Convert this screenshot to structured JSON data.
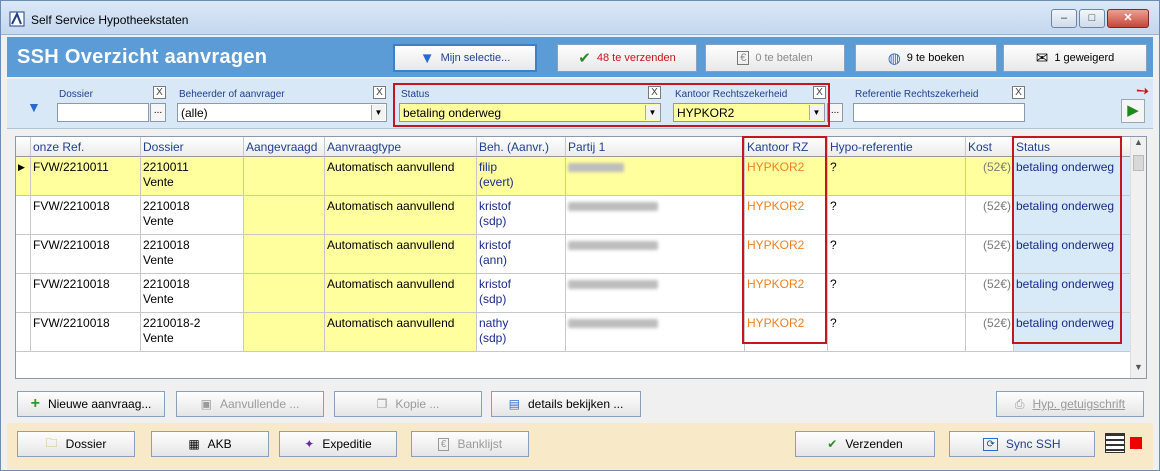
{
  "window": {
    "title": "Self Service Hypotheekstaten",
    "min": "–",
    "max": "□",
    "close": "✕"
  },
  "header": {
    "title": "SSH  Overzicht aanvragen",
    "buttons": [
      {
        "label": "Mijn selectie...",
        "icon": "funnel-icon"
      },
      {
        "label": "48 te verzenden",
        "icon": "check-send-icon",
        "color": "#c4161c"
      },
      {
        "label": "0 te betalen",
        "icon": "euro-icon"
      },
      {
        "label": "9 te boeken",
        "icon": "globe-hand-icon"
      },
      {
        "label": "1 geweigerd",
        "icon": "envelope-denied-icon"
      }
    ]
  },
  "filters": {
    "dossier": {
      "label": "Dossier",
      "value": ""
    },
    "beheerder": {
      "label": "Beheerder of aanvrager",
      "value": "(alle)"
    },
    "status": {
      "label": "Status",
      "value": "betaling onderweg"
    },
    "kantoor": {
      "label": "Kantoor Rechtszekerheid",
      "value": "HYPKOR2"
    },
    "referentie": {
      "label": "Referentie Rechtszekerheid",
      "value": ""
    },
    "clear": "X",
    "dots": "..."
  },
  "grid": {
    "columns": [
      "onze Ref.",
      "Dossier",
      "Aangevraagd",
      "Aanvraagtype",
      "Beh. (Aanvr.)",
      "Partij 1",
      "Kantoor RZ",
      "Hypo-referentie",
      "Kost",
      "Status"
    ],
    "rows": [
      {
        "ref": "FVW/2210011",
        "dossier1": "2210011",
        "dossier2": "Vente",
        "aangevraagd": "",
        "type": "Automatisch aanvullend",
        "beh1": "filip",
        "beh2": "(evert)",
        "kantoor": "HYPKOR2",
        "hypo": "?",
        "kost": "(52€)",
        "status": "betaling onderweg"
      },
      {
        "ref": "FVW/2210018",
        "dossier1": "2210018",
        "dossier2": "Vente",
        "aangevraagd": "",
        "type": "Automatisch aanvullend",
        "beh1": "kristof",
        "beh2": "(sdp)",
        "kantoor": "HYPKOR2",
        "hypo": "?",
        "kost": "(52€)",
        "status": "betaling onderweg"
      },
      {
        "ref": "FVW/2210018",
        "dossier1": "2210018",
        "dossier2": "Vente",
        "aangevraagd": "",
        "type": "Automatisch aanvullend",
        "beh1": "kristof",
        "beh2": "(ann)",
        "kantoor": "HYPKOR2",
        "hypo": "?",
        "kost": "(52€)",
        "status": "betaling onderweg"
      },
      {
        "ref": "FVW/2210018",
        "dossier1": "2210018",
        "dossier2": "Vente",
        "aangevraagd": "",
        "type": "Automatisch aanvullend",
        "beh1": "kristof",
        "beh2": "(sdp)",
        "kantoor": "HYPKOR2",
        "hypo": "?",
        "kost": "(52€)",
        "status": "betaling onderweg"
      },
      {
        "ref": "FVW/2210018",
        "dossier1": "2210018-2",
        "dossier2": "Vente",
        "aangevraagd": "",
        "type": "Automatisch aanvullend",
        "beh1": "nathy",
        "beh2": "(sdp)",
        "kantoor": "HYPKOR2",
        "hypo": "?",
        "kost": "(52€)",
        "status": "betaling onderweg"
      }
    ]
  },
  "actions": {
    "nieuwe": "Nieuwe aanvraag...",
    "aanvullende": "Aanvullende ...",
    "kopie": "Kopie ...",
    "details": "details bekijken ...",
    "hyp": "Hyp. getuigschrift"
  },
  "bottom": {
    "dossier": "Dossier",
    "akb": "AKB",
    "expeditie": "Expeditie",
    "banklijst": "Banklijst",
    "verzenden": "Verzenden",
    "sync": "Sync SSH"
  },
  "colors": {
    "accent": "#5b9bd6",
    "highlight": "#ffff9e",
    "alert": "#c4161c",
    "kantoor": "#f47f20"
  }
}
